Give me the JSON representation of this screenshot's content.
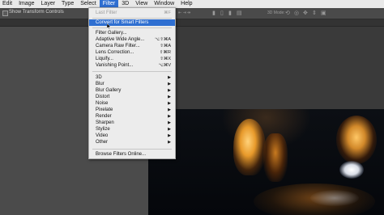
{
  "menubar": {
    "items": [
      "Edit",
      "Image",
      "Layer",
      "Type",
      "Select",
      "Filter",
      "3D",
      "View",
      "Window",
      "Help"
    ]
  },
  "options_bar": {
    "show_transform_controls": "Show Transform Controls",
    "show_transform_controls_checked": false,
    "mode_label": "3D Mode:"
  },
  "filter_menu": {
    "last_filter": {
      "label": "Last Filter",
      "shortcut": "⌘F",
      "enabled": false
    },
    "convert_smart": {
      "label": "Convert for Smart Filters"
    },
    "gallery_group": [
      {
        "label": "Filter Gallery...",
        "shortcut": ""
      },
      {
        "label": "Adaptive Wide Angle...",
        "shortcut": "⌥⇧⌘A"
      },
      {
        "label": "Camera Raw Filter...",
        "shortcut": "⇧⌘A"
      },
      {
        "label": "Lens Correction...",
        "shortcut": "⇧⌘R"
      },
      {
        "label": "Liquify...",
        "shortcut": "⇧⌘X"
      },
      {
        "label": "Vanishing Point...",
        "shortcut": "⌥⌘V"
      }
    ],
    "submenus": [
      "3D",
      "Blur",
      "Blur Gallery",
      "Distort",
      "Noise",
      "Pixelate",
      "Render",
      "Sharpen",
      "Stylize",
      "Video",
      "Other"
    ],
    "browse_online": {
      "label": "Browse Filters Online..."
    }
  },
  "colors": {
    "menu_highlight": "#2f6fd1",
    "menu_background": "#ececec",
    "app_background": "#4b4b4b"
  }
}
